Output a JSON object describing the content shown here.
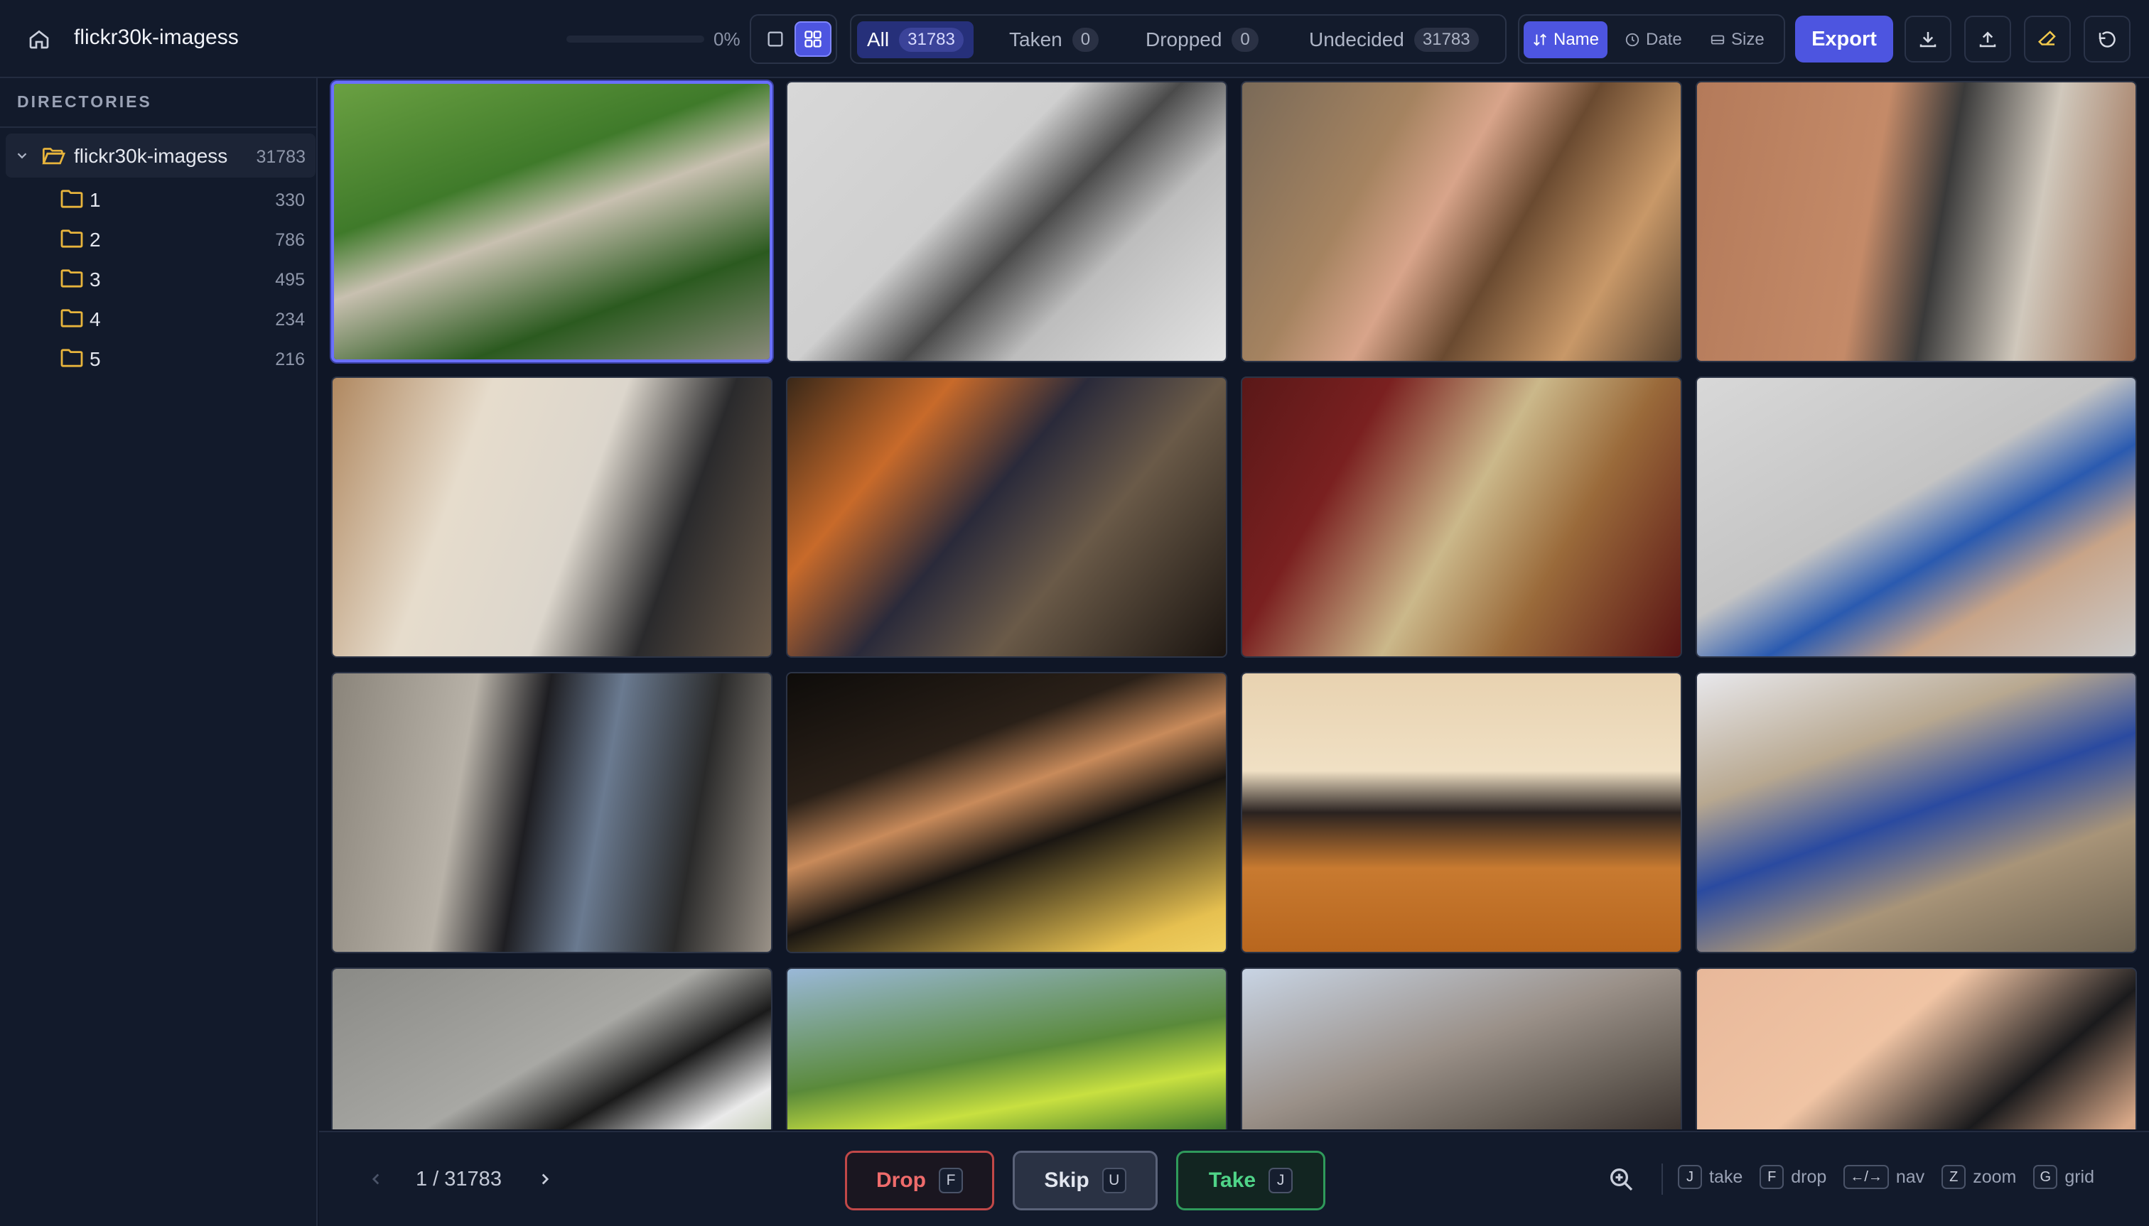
{
  "header": {
    "title": "flickr30k-imagess",
    "progress_percent": 0,
    "progress_label": "0%",
    "filters": [
      {
        "label": "All",
        "count": "31783"
      },
      {
        "label": "Taken",
        "count": "0"
      },
      {
        "label": "Dropped",
        "count": "0"
      },
      {
        "label": "Undecided",
        "count": "31783"
      }
    ],
    "sort": {
      "name": "Name",
      "date": "Date",
      "size": "Size"
    },
    "export_label": "Export",
    "accent_color": "#4d55e0"
  },
  "sidebar": {
    "heading": "DIRECTORIES",
    "root": {
      "name": "flickr30k-imagess",
      "count": "31783"
    },
    "folders": [
      {
        "name": "1",
        "count": "330"
      },
      {
        "name": "2",
        "count": "786"
      },
      {
        "name": "3",
        "count": "495"
      },
      {
        "name": "4",
        "count": "234"
      },
      {
        "name": "5",
        "count": "216"
      }
    ]
  },
  "footer": {
    "pager": "1 / 31783",
    "drop": {
      "label": "Drop",
      "key": "F"
    },
    "skip": {
      "label": "Skip",
      "key": "U"
    },
    "take": {
      "label": "Take",
      "key": "J"
    },
    "hints": [
      {
        "key": "J",
        "label": "take"
      },
      {
        "key": "F",
        "label": "drop"
      },
      {
        "key": "←/→",
        "label": "nav"
      },
      {
        "key": "Z",
        "label": "zoom"
      },
      {
        "key": "G",
        "label": "grid"
      }
    ]
  },
  "icons": [
    "home-icon",
    "single-view-icon",
    "grid-view-icon",
    "sort-name-icon",
    "clock-icon",
    "disk-icon",
    "download-icon",
    "upload-icon",
    "eraser-icon",
    "undo-icon",
    "chevron-down-icon",
    "folder-open-icon",
    "folder-icon",
    "chevron-left-icon",
    "chevron-right-icon",
    "zoom-icon"
  ]
}
